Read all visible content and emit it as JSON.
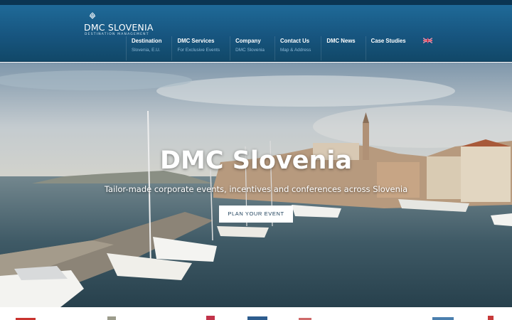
{
  "header": {
    "logo_text": "DMC SLOVENIA",
    "logo_sub": "DESTINATION MANAGEMENT",
    "nav": [
      {
        "title": "Destination",
        "sub": "Slovenia, E.U."
      },
      {
        "title": "DMC Services",
        "sub": "For Exclusive Events"
      },
      {
        "title": "Company",
        "sub": "DMC Slovenia"
      },
      {
        "title": "Contact Us",
        "sub": "Map & Address"
      },
      {
        "title": "DMC News",
        "sub": ""
      },
      {
        "title": "Case Studies",
        "sub": ""
      }
    ],
    "language_icon": "uk-flag-icon"
  },
  "hero": {
    "title": "DMC Slovenia",
    "subtitle": "Tailor-made corporate events, incentives and conferences across Slovenia",
    "cta_label": "PLAN YOUR EVENT"
  },
  "colors": {
    "header_top": "#1f6a98",
    "header_bottom": "#114868",
    "topbar": "#0b3552",
    "nav_sub": "#8fb9d6",
    "cta_text": "#1a3d58"
  }
}
